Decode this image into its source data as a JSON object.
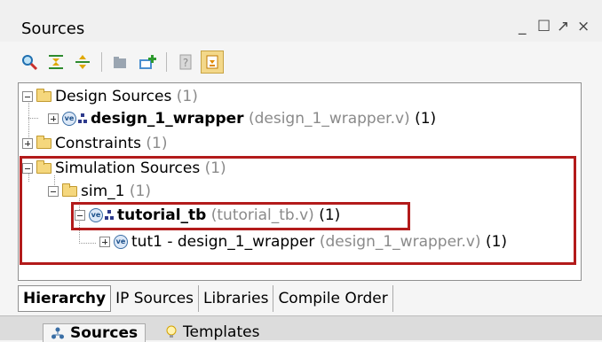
{
  "window": {
    "title": "Sources",
    "controls": {
      "minimize": "_",
      "maximize": "☐",
      "float": "↗",
      "close": "×"
    }
  },
  "toolbar": {
    "icons": [
      "search-icon",
      "collapse-all-icon",
      "expand-all-icon",
      "add-folder-icon",
      "add-sources-icon",
      "properties-icon",
      "show-hierarchy-icon"
    ]
  },
  "tree": {
    "design_sources": {
      "label": "Design Sources",
      "count": "(1)"
    },
    "design_wrapper": {
      "name": "design_1_wrapper",
      "file": "(design_1_wrapper.v)",
      "count": "(1)"
    },
    "constraints": {
      "label": "Constraints",
      "count": "(1)"
    },
    "simulation_sources": {
      "label": "Simulation Sources",
      "count": "(1)"
    },
    "sim_1": {
      "label": "sim_1",
      "count": "(1)"
    },
    "tutorial_tb": {
      "name": "tutorial_tb",
      "file": "(tutorial_tb.v)",
      "count": "(1)"
    },
    "tut1": {
      "name": "tut1 - design_1_wrapper",
      "file": "(design_1_wrapper.v)",
      "count": "(1)"
    }
  },
  "view_tabs": [
    "Hierarchy",
    "IP Sources",
    "Libraries",
    "Compile Order"
  ],
  "bottom_tabs": [
    "Sources",
    "Templates"
  ]
}
